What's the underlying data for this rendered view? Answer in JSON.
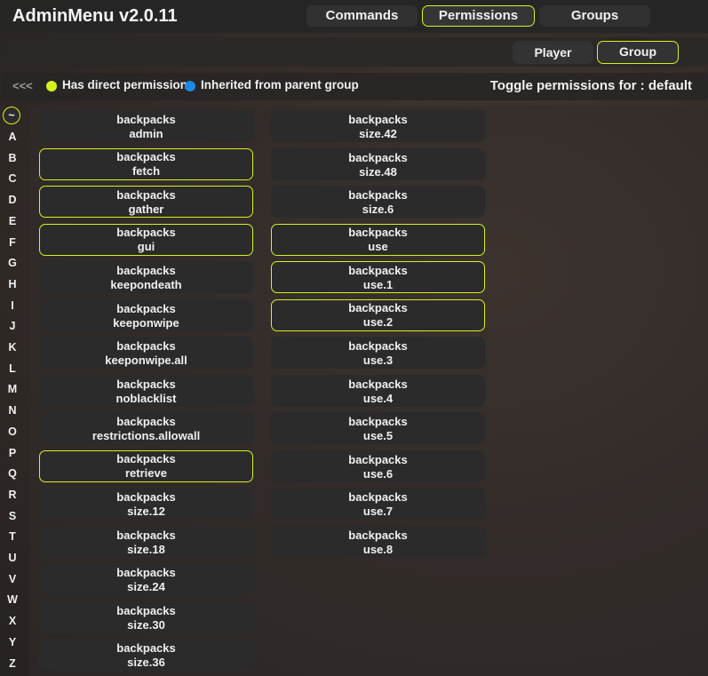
{
  "app": {
    "title": "AdminMenu v2.0.11"
  },
  "tabs": [
    {
      "label": "Commands",
      "active": false
    },
    {
      "label": "Permissions",
      "active": true
    },
    {
      "label": "Groups",
      "active": false
    }
  ],
  "subtabs": [
    {
      "label": "Player",
      "active": false
    },
    {
      "label": "Group",
      "active": true
    }
  ],
  "legend": {
    "back": "<<<",
    "direct": "Has direct permission",
    "inherited": "Inherited from parent group",
    "direct_color": "#d6f21c",
    "inherited_color": "#1e88e5",
    "toggle": "Toggle permissions for : default"
  },
  "letters": [
    "~",
    "A",
    "B",
    "C",
    "D",
    "E",
    "F",
    "G",
    "H",
    "I",
    "J",
    "K",
    "L",
    "M",
    "N",
    "O",
    "P",
    "Q",
    "R",
    "S",
    "T",
    "U",
    "V",
    "W",
    "X",
    "Y",
    "Z"
  ],
  "columns": [
    [
      {
        "group": "backpacks",
        "name": "admin",
        "direct": false
      },
      {
        "group": "backpacks",
        "name": "fetch",
        "direct": true
      },
      {
        "group": "backpacks",
        "name": "gather",
        "direct": true
      },
      {
        "group": "backpacks",
        "name": "gui",
        "direct": true
      },
      {
        "group": "backpacks",
        "name": "keepondeath",
        "direct": false
      },
      {
        "group": "backpacks",
        "name": "keeponwipe",
        "direct": false
      },
      {
        "group": "backpacks",
        "name": "keeponwipe.all",
        "direct": false
      },
      {
        "group": "backpacks",
        "name": "noblacklist",
        "direct": false
      },
      {
        "group": "backpacks",
        "name": "restrictions.allowall",
        "direct": false
      },
      {
        "group": "backpacks",
        "name": "retrieve",
        "direct": true
      },
      {
        "group": "backpacks",
        "name": "size.12",
        "direct": false
      },
      {
        "group": "backpacks",
        "name": "size.18",
        "direct": false
      },
      {
        "group": "backpacks",
        "name": "size.24",
        "direct": false
      },
      {
        "group": "backpacks",
        "name": "size.30",
        "direct": false
      },
      {
        "group": "backpacks",
        "name": "size.36",
        "direct": false
      }
    ],
    [
      {
        "group": "backpacks",
        "name": "size.42",
        "direct": false
      },
      {
        "group": "backpacks",
        "name": "size.48",
        "direct": false
      },
      {
        "group": "backpacks",
        "name": "size.6",
        "direct": false
      },
      {
        "group": "backpacks",
        "name": "use",
        "direct": true
      },
      {
        "group": "backpacks",
        "name": "use.1",
        "direct": true
      },
      {
        "group": "backpacks",
        "name": "use.2",
        "direct": true
      },
      {
        "group": "backpacks",
        "name": "use.3",
        "direct": false
      },
      {
        "group": "backpacks",
        "name": "use.4",
        "direct": false
      },
      {
        "group": "backpacks",
        "name": "use.5",
        "direct": false
      },
      {
        "group": "backpacks",
        "name": "use.6",
        "direct": false
      },
      {
        "group": "backpacks",
        "name": "use.7",
        "direct": false
      },
      {
        "group": "backpacks",
        "name": "use.8",
        "direct": false
      }
    ]
  ]
}
